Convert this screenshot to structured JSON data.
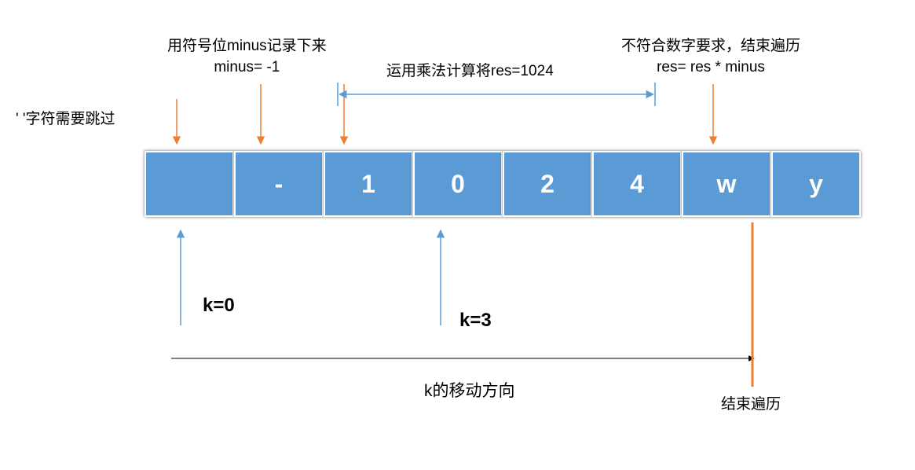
{
  "annotations": {
    "skip_label": "' '字符需要跳过",
    "minus_line1": "用符号位minus记录下来",
    "minus_line2": "minus= -1",
    "mult_label": "运用乘法计算将res=1024",
    "end_line1": "不符合数字要求，结束遍历",
    "end_line2": "res= res * minus"
  },
  "cells": [
    "",
    "-",
    "1",
    "0",
    "2",
    "4",
    "w",
    "y"
  ],
  "pointers": {
    "k0": "k=0",
    "k3": "k=3"
  },
  "movement_label": "k的移动方向",
  "end_traverse": "结束遍历"
}
